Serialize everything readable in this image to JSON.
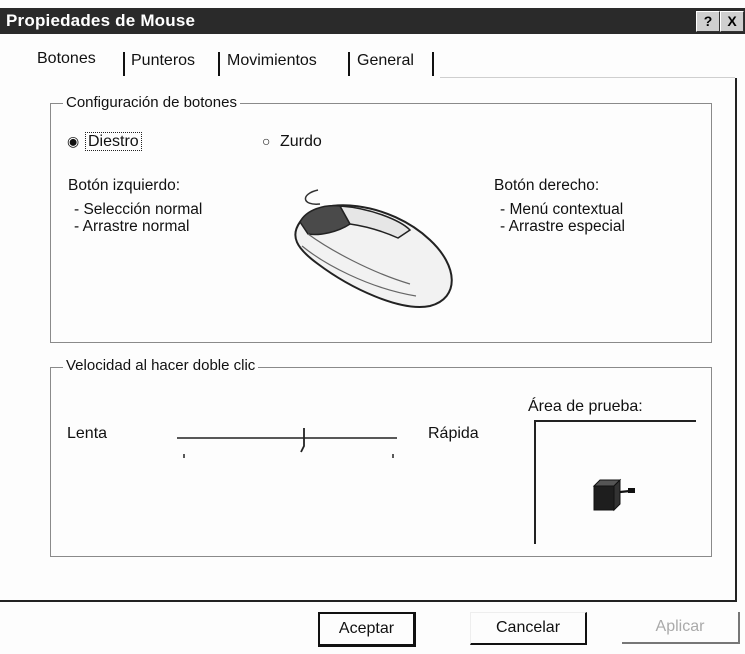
{
  "window": {
    "title": "Propiedades de Mouse",
    "help_label": "?",
    "close_label": "X"
  },
  "tabs": [
    {
      "label": "Botones",
      "active": true
    },
    {
      "label": "Punteros",
      "active": false
    },
    {
      "label": "Movimientos",
      "active": false
    },
    {
      "label": "General",
      "active": false
    }
  ],
  "buttons_config": {
    "legend": "Configuración de botones",
    "radio_right": {
      "label": "Diestro",
      "selected": true
    },
    "radio_left": {
      "label": "Zurdo",
      "selected": false
    },
    "left_button_heading": "Botón izquierdo:",
    "left_button_items": [
      "- Selección normal",
      "- Arrastre normal"
    ],
    "right_button_heading": "Botón derecho:",
    "right_button_items": [
      "- Menú contextual",
      "- Arrastre especial"
    ],
    "mouse_icon": "mouse-icon"
  },
  "double_click": {
    "legend": "Velocidad al hacer doble clic",
    "slow_label": "Lenta",
    "fast_label": "Rápida",
    "slider_value": 0.5,
    "test_area_label": "Área de prueba:",
    "test_icon": "jack-in-the-box-icon"
  },
  "footer": {
    "ok_label": "Aceptar",
    "cancel_label": "Cancelar",
    "apply_label": "Aplicar"
  }
}
